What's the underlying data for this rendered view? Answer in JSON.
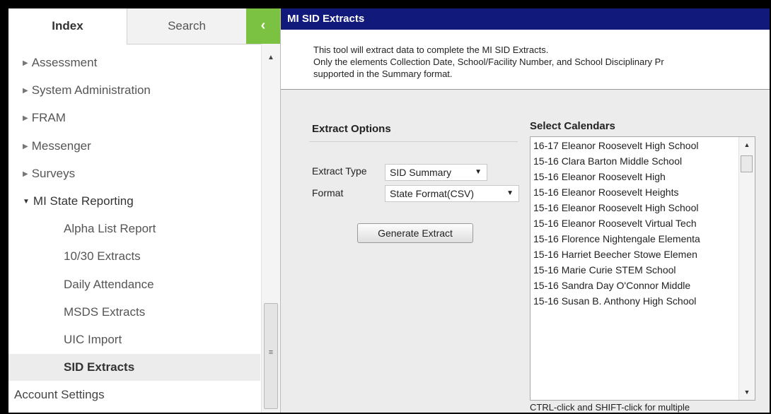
{
  "nav": {
    "tabs": {
      "index": "Index",
      "search": "Search"
    },
    "collapse_symbol": "‹",
    "items": [
      {
        "label": "Assessment",
        "type": "folder"
      },
      {
        "label": "System Administration",
        "type": "folder"
      },
      {
        "label": "FRAM",
        "type": "folder"
      },
      {
        "label": "Messenger",
        "type": "folder"
      },
      {
        "label": "Surveys",
        "type": "folder"
      },
      {
        "label": "MI State Reporting",
        "type": "folder-open"
      },
      {
        "label": "Alpha List Report",
        "type": "child"
      },
      {
        "label": "10/30 Extracts",
        "type": "child"
      },
      {
        "label": "Daily Attendance",
        "type": "child"
      },
      {
        "label": "MSDS Extracts",
        "type": "child"
      },
      {
        "label": "UIC Import",
        "type": "child"
      },
      {
        "label": "SID Extracts",
        "type": "child-selected"
      },
      {
        "label": "Account Settings",
        "type": "root"
      }
    ]
  },
  "page": {
    "title": "MI SID Extracts",
    "description": [
      "This tool will extract data to complete the MI SID Extracts.",
      "Only the elements Collection Date, School/Facility Number, and School Disciplinary Pr",
      "supported in the Summary format."
    ]
  },
  "extract_options": {
    "heading": "Extract Options",
    "extract_type_label": "Extract Type",
    "extract_type_value": "SID Summary",
    "format_label": "Format",
    "format_value": "State Format(CSV)",
    "generate_button": "Generate Extract"
  },
  "calendars": {
    "heading": "Select Calendars",
    "items": [
      "16-17 Eleanor Roosevelt High School",
      "15-16 Clara Barton Middle School",
      "15-16 Eleanor Roosevelt High",
      "15-16 Eleanor Roosevelt Heights",
      "15-16 Eleanor Roosevelt High School",
      "15-16 Eleanor Roosevelt Virtual Tech",
      "15-16 Florence Nightengale Elementa",
      "15-16 Harriet Beecher Stowe Elemen",
      "15-16 Marie Curie STEM School",
      "15-16 Sandra Day O'Connor Middle",
      "15-16 Susan B. Anthony High School"
    ],
    "hint": "CTRL-click and SHIFT-click for multiple"
  },
  "colors": {
    "title_bar": "#11197a",
    "collapse_button": "#7cc242",
    "content_background": "#ececec"
  }
}
